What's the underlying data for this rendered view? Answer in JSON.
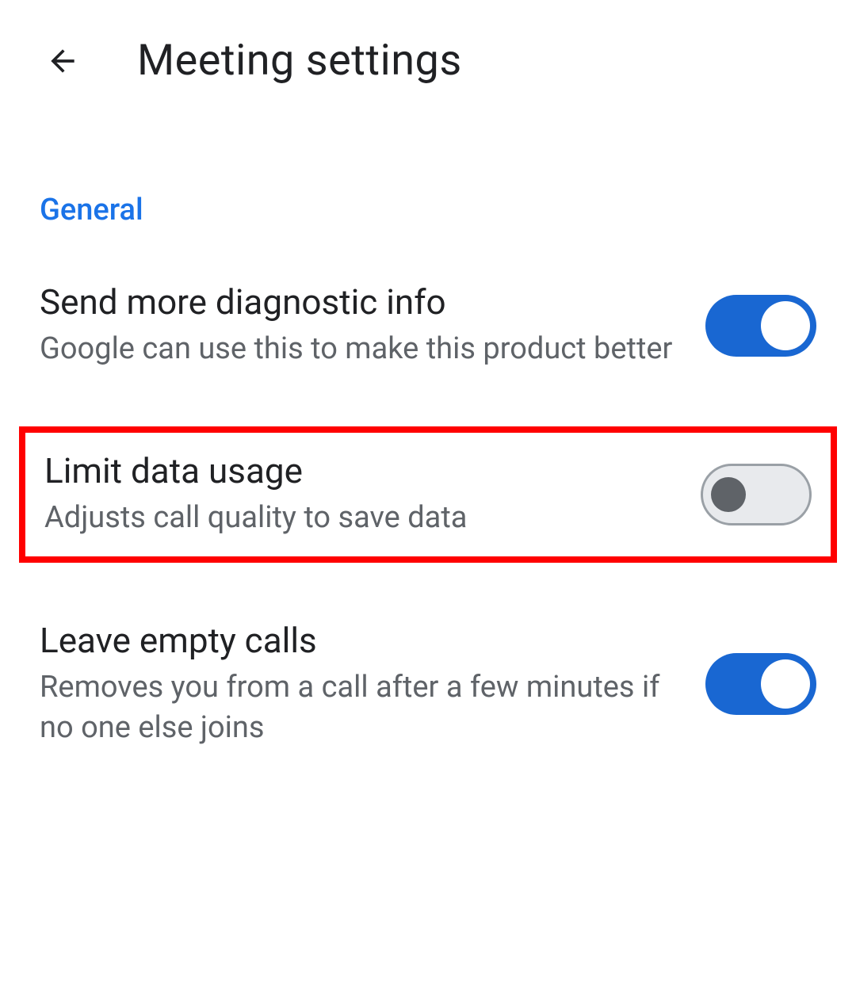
{
  "header": {
    "title": "Meeting settings"
  },
  "section": {
    "label": "General"
  },
  "settings": {
    "diagnostic": {
      "title": "Send more diagnostic info",
      "description": "Google can use this to make this product better",
      "enabled": true
    },
    "limitData": {
      "title": "Limit data usage",
      "description": "Adjusts call quality to save data",
      "enabled": false,
      "highlighted": true
    },
    "leaveEmpty": {
      "title": "Leave empty calls",
      "description": "Removes you from a call after a few minutes if no one else joins",
      "enabled": true
    }
  }
}
